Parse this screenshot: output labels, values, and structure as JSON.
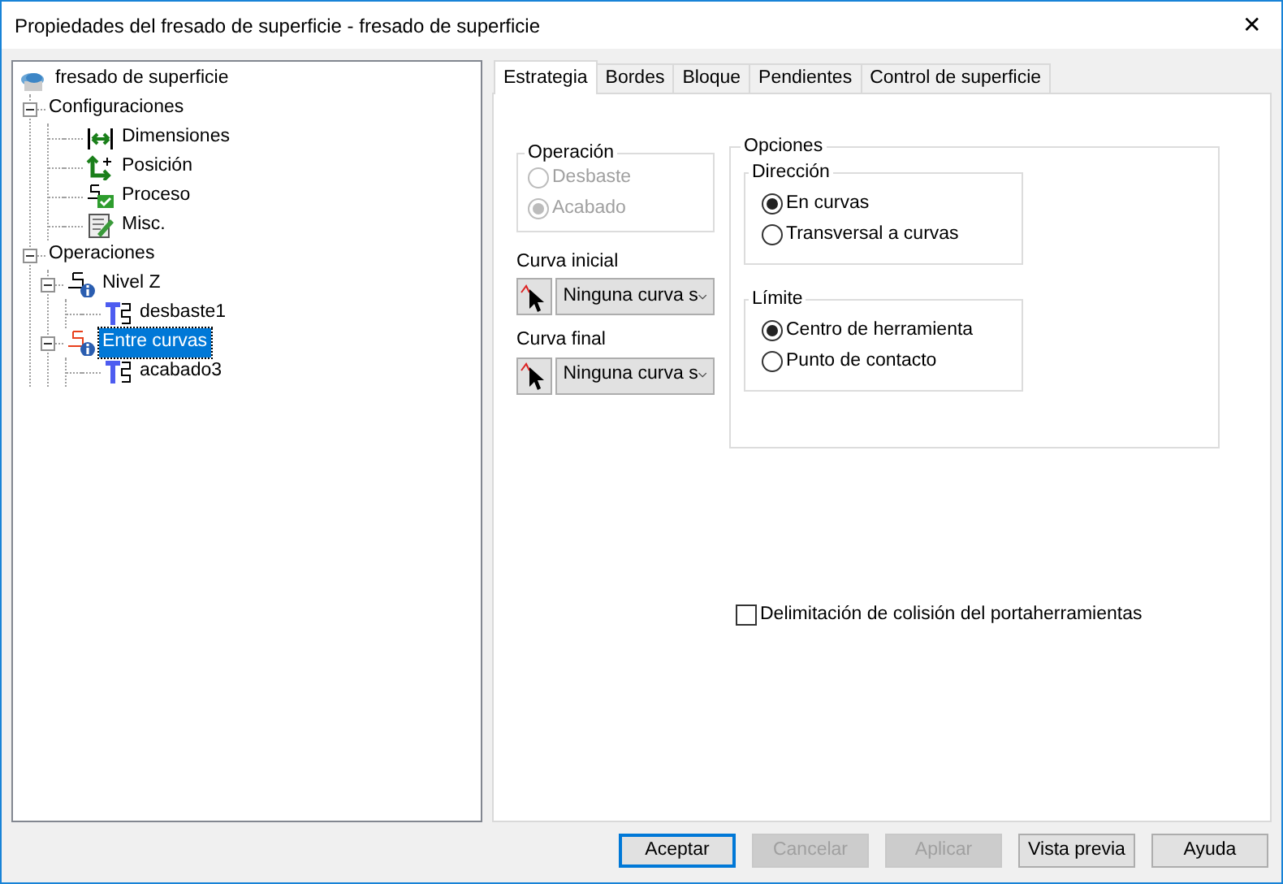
{
  "window": {
    "title": "Propiedades del fresado de superficie - fresado de superficie",
    "close": "✕"
  },
  "tree": [
    {
      "label": "fresado de superficie",
      "kind": "root",
      "selected": false,
      "children": [
        {
          "label": "Configuraciones",
          "expanded": true,
          "selected": false,
          "children": [
            {
              "label": "Dimensiones",
              "kind": "dimensions",
              "selected": false
            },
            {
              "label": "Posición",
              "kind": "position",
              "selected": false
            },
            {
              "label": "Proceso",
              "kind": "process",
              "selected": false
            },
            {
              "label": "Misc.",
              "kind": "misc",
              "selected": false
            }
          ]
        },
        {
          "label": "Operaciones",
          "expanded": true,
          "selected": false,
          "children": [
            {
              "label": "Nivel Z",
              "kind": "operation",
              "color": "#000000",
              "expanded": true,
              "selected": false,
              "children": [
                {
                  "label": "desbaste1",
                  "kind": "toolpath",
                  "selected": false
                }
              ]
            },
            {
              "label": "Entre curvas",
              "kind": "operation",
              "color": "#e8401c",
              "expanded": true,
              "selected": true,
              "children": [
                {
                  "label": "acabado3",
                  "kind": "toolpath",
                  "selected": false
                }
              ]
            }
          ]
        }
      ]
    }
  ],
  "tabs": [
    {
      "label": "Estrategia",
      "selected": true
    },
    {
      "label": "Bordes",
      "selected": false
    },
    {
      "label": "Bloque",
      "selected": false
    },
    {
      "label": "Pendientes",
      "selected": false
    },
    {
      "label": "Control de superficie",
      "selected": false
    }
  ],
  "operation_group": {
    "title": "Operación",
    "disabled": true,
    "options": [
      {
        "label": "Desbaste",
        "selected": false
      },
      {
        "label": "Acabado",
        "selected": true
      }
    ]
  },
  "curve_pickers": [
    {
      "label": "Curva inicial",
      "value": "Ninguna curva s"
    },
    {
      "label": "Curva final",
      "value": "Ninguna curva s"
    }
  ],
  "options_group": {
    "title": "Opciones",
    "groups": [
      {
        "title": "Dirección",
        "options": [
          {
            "label": "En curvas",
            "selected": true
          },
          {
            "label": "Transversal a curvas",
            "selected": false
          }
        ]
      },
      {
        "title": "Límite",
        "options": [
          {
            "label": "Centro de herramienta",
            "selected": true
          },
          {
            "label": "Punto de contacto",
            "selected": false
          }
        ]
      }
    ]
  },
  "holder_collision": {
    "label": "Delimitación de colisión del portaherramientas",
    "checked": false
  },
  "buttons": [
    {
      "label": "Aceptar",
      "disabled": false,
      "default": true
    },
    {
      "label": "Cancelar",
      "disabled": true,
      "default": false
    },
    {
      "label": "Aplicar",
      "disabled": true,
      "default": false
    },
    {
      "label": "Vista previa",
      "disabled": false,
      "default": false
    },
    {
      "label": "Ayuda",
      "disabled": false,
      "default": false
    }
  ]
}
